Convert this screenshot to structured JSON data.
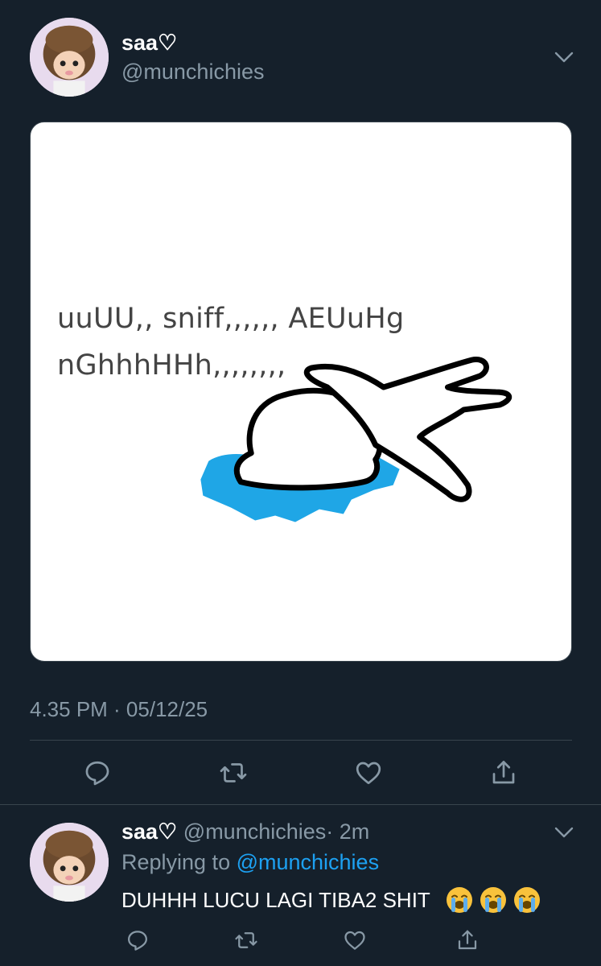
{
  "tweet": {
    "display_name": "saa♡",
    "handle": "@munchichies",
    "image_text": [
      "uuUU,, sniff,,,,,, AEUuHg",
      "nGhhhHHh,,,,,,,,"
    ],
    "timestamp": "4.35 PM · 05/12/25"
  },
  "reply": {
    "display_name": "saa♡",
    "handle": "@munchichies",
    "time": "· 2m",
    "replying_prefix": "Replying to ",
    "replying_to": "@munchichies",
    "text": "DUHHH LUCU LAGI TIBA2 SHIT"
  },
  "icons": {
    "reply": "comment-icon",
    "retweet": "retweet-icon",
    "like": "heart-icon",
    "share": "share-icon",
    "more": "chevron-down-icon",
    "emoji": "loudly-crying-face-emoji"
  },
  "colors": {
    "background": "#15202b",
    "secondary_text": "#8899a6",
    "link": "#1da1f2",
    "divider": "#38444d",
    "puddle": "#1fa6e6"
  }
}
